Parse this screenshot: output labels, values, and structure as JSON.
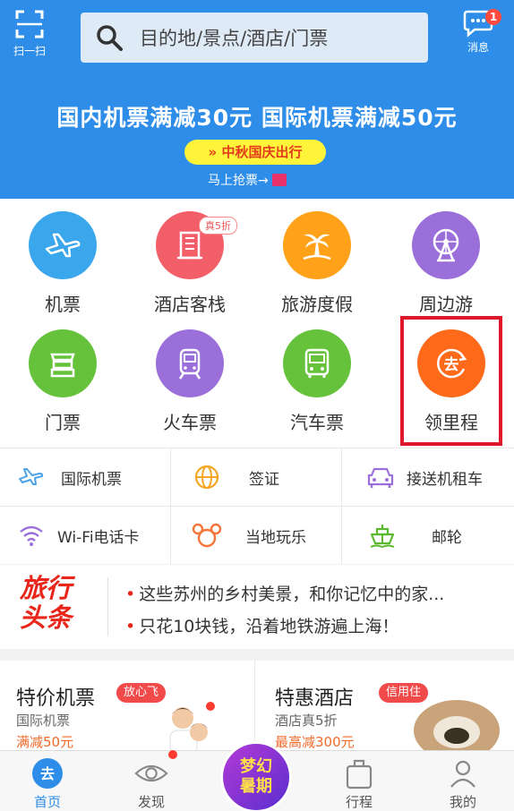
{
  "header": {
    "scan_label": "扫一扫",
    "search_placeholder": "目的地/景点/酒店/门票",
    "message_label": "消息",
    "message_badge": "1",
    "promo_title": "国内机票满减30元 国际机票满减50元",
    "promo_pill": "» 中秋国庆出行",
    "grab_text": "马上抢票→"
  },
  "main_icons": [
    {
      "label": "机票",
      "icon": "plane-icon",
      "color": "#3aa6ec"
    },
    {
      "label": "酒店客栈",
      "icon": "hotel-icon",
      "color": "#f25f69",
      "tag": "真5折"
    },
    {
      "label": "旅游度假",
      "icon": "palm-tree-icon",
      "color": "#ffa21a"
    },
    {
      "label": "周边游",
      "icon": "ferris-wheel-icon",
      "color": "#9b6fd9"
    },
    {
      "label": "门票",
      "icon": "gate-ticket-icon",
      "color": "#66c23a"
    },
    {
      "label": "火车票",
      "icon": "train-icon",
      "color": "#9b6fd9"
    },
    {
      "label": "汽车票",
      "icon": "bus-icon",
      "color": "#66c23a"
    },
    {
      "label": "领里程",
      "icon": "mileage-icon",
      "color": "#ff6a1a"
    }
  ],
  "secondary": [
    {
      "label": "国际机票",
      "icon": "plane-outline-icon"
    },
    {
      "label": "签证",
      "icon": "globe-icon"
    },
    {
      "label": "接送机租车",
      "icon": "car-icon"
    },
    {
      "label": "Wi-Fi电话卡",
      "icon": "wifi-icon"
    },
    {
      "label": "当地玩乐",
      "icon": "mickey-icon"
    },
    {
      "label": "邮轮",
      "icon": "ship-icon"
    }
  ],
  "news": {
    "logo_line1": "旅行",
    "logo_line2": "头条",
    "items": [
      "这些苏州的乡村美景，和你记忆中的家...",
      "只花10块钱，沿着地铁游遍上海！"
    ]
  },
  "deals": [
    {
      "title": "特价机票",
      "tag": "放心飞",
      "sub": "国际机票",
      "price": "满减50元"
    },
    {
      "title": "特惠酒店",
      "tag": "信用住",
      "sub": "酒店真5折",
      "price": "最高减300元"
    }
  ],
  "tabs": [
    {
      "label": "首页",
      "icon": "home-icon"
    },
    {
      "label": "发现",
      "icon": "eye-icon"
    },
    {
      "label": "行程",
      "icon": "luggage-icon"
    },
    {
      "label": "我的",
      "icon": "user-icon"
    }
  ],
  "center_button": {
    "line1": "梦幻",
    "line2": "暑期"
  },
  "colors": {
    "primary": "#2e8de8",
    "highlight_box": "#e0162b"
  }
}
